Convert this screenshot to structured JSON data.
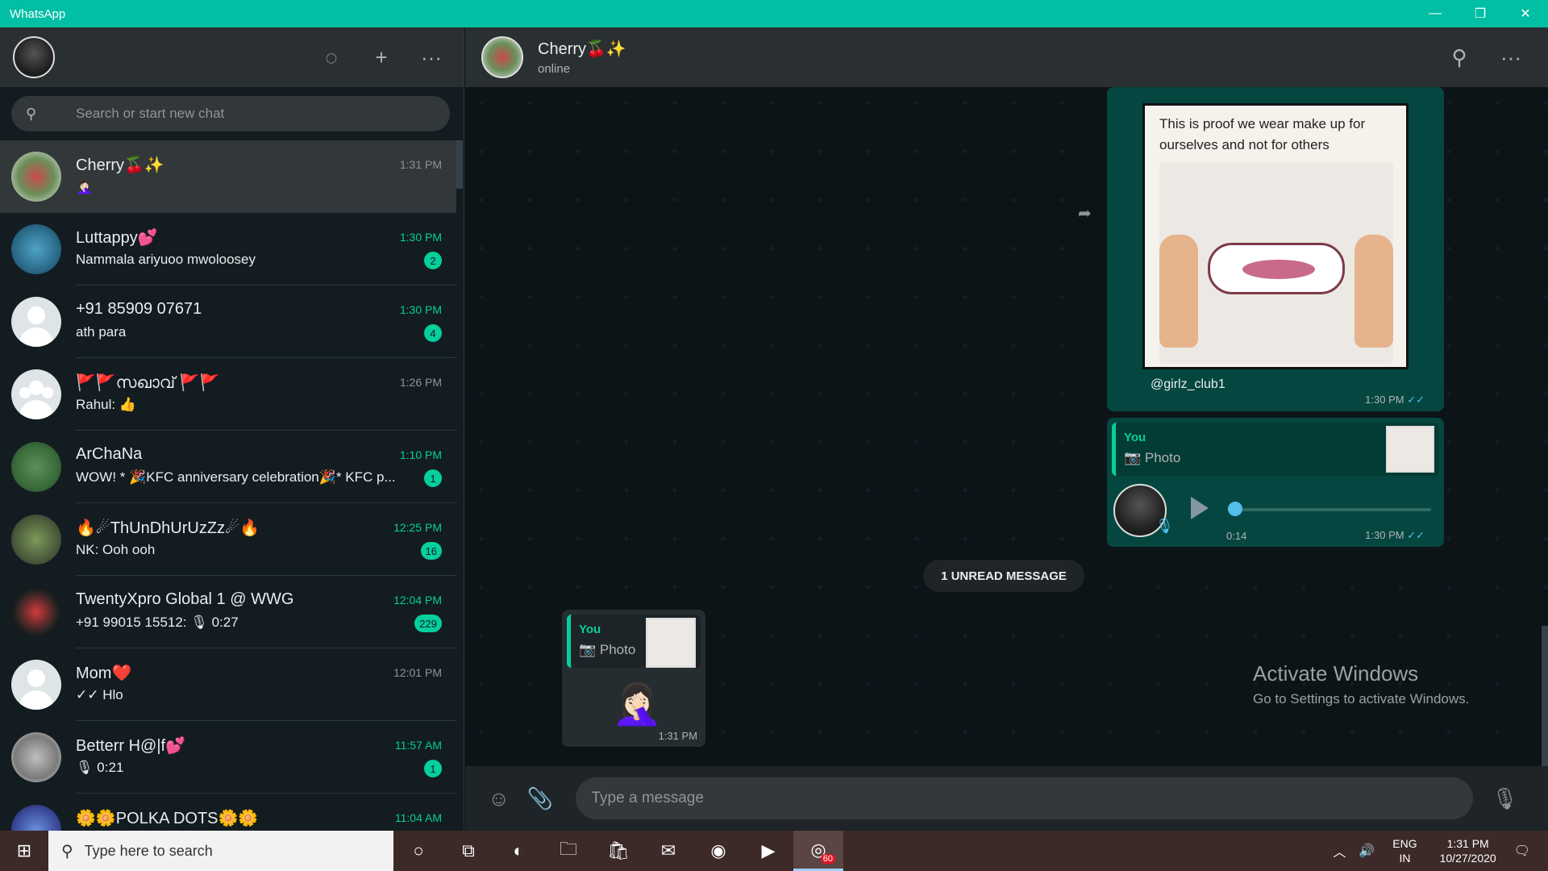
{
  "window": {
    "title": "WhatsApp"
  },
  "left_header": {
    "new_chat_symbol": "+",
    "menu_symbol": "···"
  },
  "search": {
    "placeholder": "Search or start new chat"
  },
  "chats": [
    {
      "name": "Cherry🍒✨",
      "time": "1:31 PM",
      "preview": "🤦🏻‍♀️",
      "badge": "",
      "unread": false
    },
    {
      "name": "Luttappy💕",
      "time": "1:30 PM",
      "preview": "Nammala ariyuoo mwoloosey",
      "badge": "2",
      "unread": true
    },
    {
      "name": "+91 85909 07671",
      "time": "1:30 PM",
      "preview": "ath para",
      "badge": "4",
      "unread": true
    },
    {
      "name": "🚩🚩സഖാവ് 🚩🚩",
      "time": "1:26 PM",
      "preview": "Rahul: 👍",
      "badge": "",
      "unread": false
    },
    {
      "name": "ArChaNa",
      "time": "1:10 PM",
      "preview": "WOW! * 🎉KFC anniversary celebration🎉* KFC p...",
      "badge": "1",
      "unread": true
    },
    {
      "name": "🔥☄ThUnDhUrUzZz☄🔥",
      "time": "12:25 PM",
      "preview": "NK: Ooh ooh",
      "badge": "16",
      "unread": true
    },
    {
      "name": "TwentyXpro Global 1 @ WWG",
      "time": "12:04 PM",
      "preview": "+91 99015 15512: 🎙 0:27",
      "badge": "229",
      "unread": true
    },
    {
      "name": "Mom❤️",
      "time": "12:01 PM",
      "preview": "✓✓ Hlo",
      "badge": "",
      "unread": false
    },
    {
      "name": "Betterr H@|f💕",
      "time": "11:57 AM",
      "preview": "🎙 0:21",
      "badge": "1",
      "unread": true
    },
    {
      "name": "🌼🌼POLKA DOTS🌼🌼",
      "time": "11:04 AM",
      "preview": "",
      "badge": "",
      "unread": true
    }
  ],
  "conversation": {
    "contact_name": "Cherry🍒✨",
    "status": "online",
    "image_message": {
      "image_text": "This is proof we wear make up for ourselves and not for others",
      "caption": "@girlz_club1",
      "time": "1:30 PM",
      "ticks": "✓✓"
    },
    "voice_message": {
      "quote_author": "You",
      "quote_type": "📷 Photo",
      "duration": "0:14",
      "time": "1:30 PM",
      "ticks": "✓✓"
    },
    "unread_label": "1 UNREAD MESSAGE",
    "reply_message": {
      "quote_author": "You",
      "quote_type": "📷 Photo",
      "emoji": "🤦🏻‍♀️",
      "time": "1:31 PM"
    }
  },
  "composer": {
    "placeholder": "Type a message"
  },
  "watermark": {
    "line1": "Activate Windows",
    "line2": "Go to Settings to activate Windows."
  },
  "taskbar": {
    "search_text": "Type here to search",
    "whatsapp_badge": "60",
    "lang_line1": "ENG",
    "lang_line2": "IN",
    "clock_time": "1:31 PM",
    "clock_date": "10/27/2020"
  }
}
